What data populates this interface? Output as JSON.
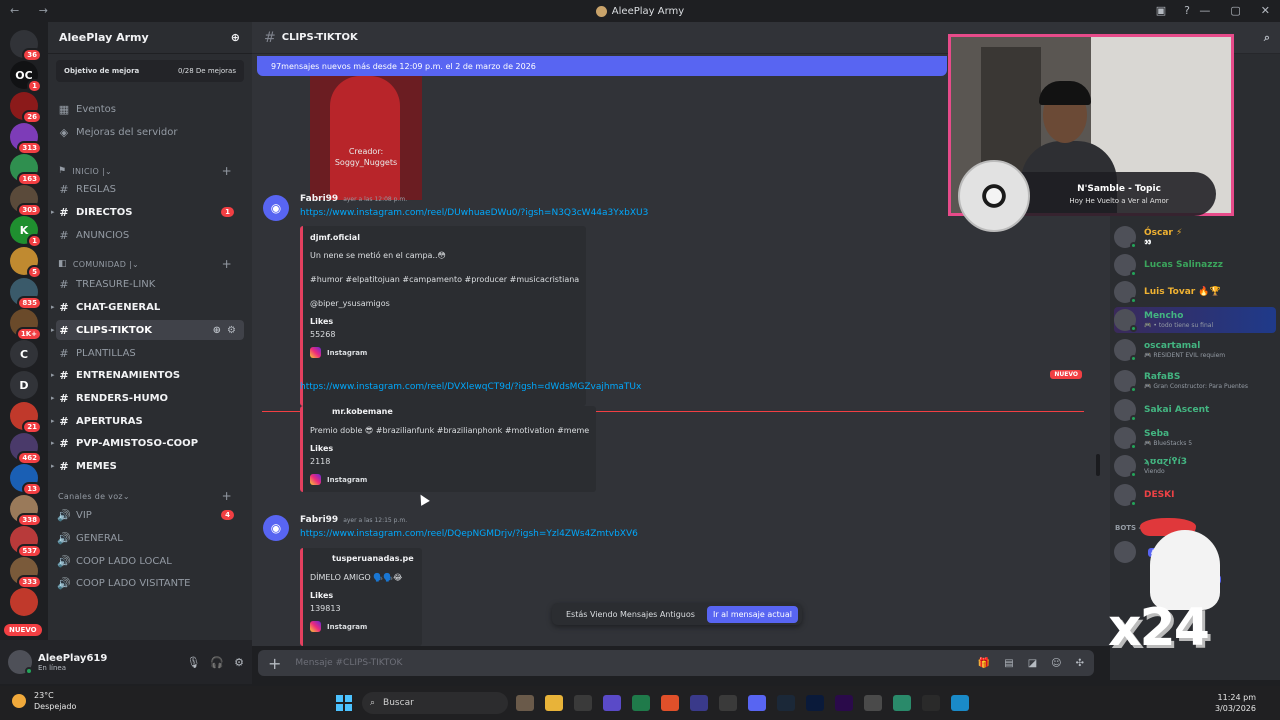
{
  "titlebar": {
    "title": "AleePlay Army",
    "nav": "← →",
    "window_controls": [
      "—",
      "▢",
      "✕"
    ],
    "icons": [
      "inbox-icon",
      "help-icon"
    ]
  },
  "servers": [
    {
      "label": "",
      "badge": "36",
      "color": "#313338"
    },
    {
      "label": "OC",
      "badge": "1",
      "color": "#111214"
    },
    {
      "label": "",
      "badge": "26",
      "color": "#8b1a1a"
    },
    {
      "label": "",
      "badge": "313",
      "color": "#7d3cb8"
    },
    {
      "label": "",
      "badge": "163",
      "color": "#2f8f4f"
    },
    {
      "label": "",
      "badge": "303",
      "color": "#5a4a3a"
    },
    {
      "label": "K",
      "badge": "1",
      "color": "#1f8f2f"
    },
    {
      "label": "",
      "badge": "5",
      "color": "#c08a30"
    },
    {
      "label": "",
      "badge": "835",
      "color": "#3a5a6a"
    },
    {
      "label": "",
      "badge": "1K+",
      "color": "#6a4a2a"
    },
    {
      "label": "C",
      "badge": "",
      "color": "#313338"
    },
    {
      "label": "D",
      "badge": "",
      "color": "#313338"
    },
    {
      "label": "",
      "badge": "21",
      "color": "#c0392b"
    },
    {
      "label": "",
      "badge": "462",
      "color": "#4a3a6a"
    },
    {
      "label": "",
      "badge": "13",
      "color": "#1a5fb4"
    },
    {
      "label": "",
      "badge": "338",
      "color": "#9a7a5a"
    },
    {
      "label": "",
      "badge": "537",
      "color": "#b83a3a"
    },
    {
      "label": "",
      "badge": "333",
      "color": "#7a5a3a"
    },
    {
      "label": "",
      "badge": "",
      "color": "#c0392b"
    }
  ],
  "servers_new_pill": "NUEVO",
  "sidebar": {
    "server_name": "AleePlay Army",
    "boost_label": "Objetivo de mejora",
    "boost_progress": "0/28 De mejoras",
    "top_items": [
      {
        "icon": "▦",
        "label": "Eventos"
      },
      {
        "icon": "◈",
        "label": "Mejoras del servidor"
      }
    ],
    "cat_inicio": "INICIO |",
    "cat_comunidad": "COMUNIDAD |",
    "cat_voz": "Canales de voz",
    "channels": [
      {
        "label": "REGLAS",
        "bold": false
      },
      {
        "label": "DIRECTOS",
        "bold": true,
        "badge": "1"
      },
      {
        "label": "ANUNCIOS",
        "bold": false
      },
      {
        "label": "TREASURE-LINK",
        "bold": false
      },
      {
        "label": "CHAT-GENERAL",
        "bold": true
      },
      {
        "label": "CLIPS-TIKTOK",
        "bold": true
      },
      {
        "label": "PLANTILLAS",
        "bold": false
      },
      {
        "label": "ENTRENAMIENTOS",
        "bold": true
      },
      {
        "label": "RENDERS-HUMO",
        "bold": true
      },
      {
        "label": "APERTURAS",
        "bold": true
      },
      {
        "label": "PVP-AMISTOSO-COOP",
        "bold": true
      },
      {
        "label": "MEMES",
        "bold": true
      }
    ],
    "voice": [
      {
        "label": "VIP",
        "badge": "4"
      },
      {
        "label": "GENERAL"
      },
      {
        "label": "COOP LADO LOCAL"
      },
      {
        "label": "COOP LADO VISITANTE"
      }
    ]
  },
  "user": {
    "name": "AleePlay619",
    "status": "En línea"
  },
  "channel": {
    "name": "CLIPS-TIKTOK"
  },
  "chat": {
    "new_messages": "97mensajes nuevos más desde 12:09 p.m. el 2 de marzo de 2026",
    "image_caption": "Creador:\nSoggy_Nuggets",
    "msg1": {
      "author": "Fabri99",
      "time": "ayer a las 12:08 p.m.",
      "link": "https://www.instagram.com/reel/DUwhuaeDWu0/?igsh=N3Q3cW44a3YxbXU3"
    },
    "embed1": {
      "author": "djmf.oficial",
      "text1": "Un nene se metió en el campa..😳",
      "text2": "#humor #elpatitojuan #campamento #producer #musicacristiana",
      "text3": "@biper_ysusamigos",
      "likes_label": "Likes",
      "likes": "55268",
      "provider": "Instagram"
    },
    "link2": "https://www.instagram.com/reel/DVXlewqCT9d/?igsh=dWdsMGZvajhmaTUx",
    "new_label": "NUEVO",
    "embed2": {
      "author": "mr.kobemane",
      "text1": "Premio doble 😎 #brazilianfunk #brazilianphonk #motivation #meme",
      "likes_label": "Likes",
      "likes": "2118",
      "provider": "Instagram"
    },
    "msg2": {
      "author": "Fabri99",
      "time": "ayer a las 12:15 p.m.",
      "link": "https://www.instagram.com/reel/DQepNGMDrjv/?igsh=Yzl4ZWs4ZmtvbXV6"
    },
    "embed3": {
      "author": "tusperuanadas.pe",
      "text1": "DÍMELO AMIGO 🗣️🗣️😂",
      "likes_label": "Likes",
      "likes": "139813",
      "provider": "Instagram"
    },
    "old_notice": "Estás Viendo Mensajes Antiguos",
    "jump_label": "Ir al mensaje actual",
    "compose_placeholder": "Mensaje #CLIPS-TIKTOK"
  },
  "music": {
    "title": "N'Samble - Topic",
    "subtitle": "Hoy He Vuelto a Ver al Amor"
  },
  "members": [
    {
      "name": "Óscar ⚡",
      "sub": "👀",
      "color": "#f0b232"
    },
    {
      "name": "Lucas Salinazzz",
      "sub": "",
      "color": "#3ba55c"
    },
    {
      "name": "Luis Tovar 🔥🏆",
      "sub": "",
      "color": "#f0b232"
    },
    {
      "name": "Mencho",
      "sub": "🎮 • todo tiene su final",
      "color": "#43b581"
    },
    {
      "name": "oscartamal",
      "sub": "🎮 RESIDENT EVIL requiem",
      "color": "#43b581"
    },
    {
      "name": "RafaBS",
      "sub": "🎮 Gran Constructor: Para Puentes",
      "color": "#43b581"
    },
    {
      "name": "Sakai Ascent",
      "sub": "",
      "color": "#43b581"
    },
    {
      "name": "Seba",
      "sub": "🎮 BlueStacks 5",
      "color": "#43b581"
    },
    {
      "name": "ϡʊɑɀí߉í3",
      "sub": "Viendo",
      "color": "#43b581"
    },
    {
      "name": "DESKI",
      "sub": "",
      "color": "#ed4245"
    }
  ],
  "bots_label": "BOTS —",
  "app_label": "APP",
  "overlay_text": "x24",
  "taskbar": {
    "temp": "23°C",
    "weather": "Despejado",
    "search": "Buscar",
    "time": "11:24 pm",
    "date": "3/03/2026"
  }
}
